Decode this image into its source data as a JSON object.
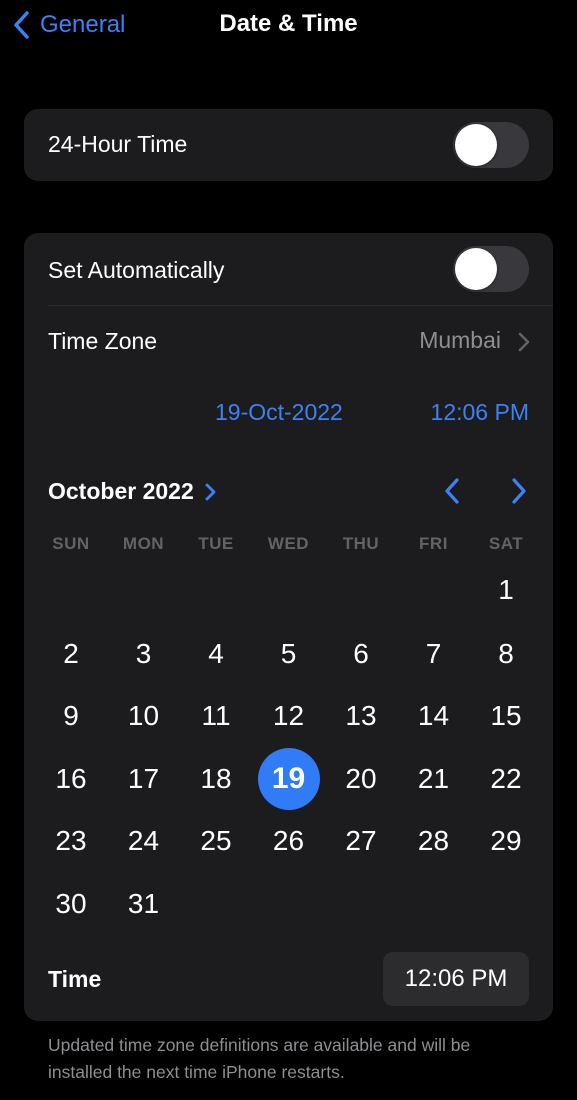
{
  "nav": {
    "back_label": "General",
    "title": "Date & Time"
  },
  "hour24": {
    "label": "24-Hour Time",
    "on": false
  },
  "auto": {
    "label": "Set Automatically",
    "on": false
  },
  "timezone": {
    "label": "Time Zone",
    "value": "Mumbai"
  },
  "summary": {
    "date": "19-Oct-2022",
    "time": "12:06 PM"
  },
  "calendar": {
    "month_label": "October 2022",
    "weekdays": [
      "SUN",
      "MON",
      "TUE",
      "WED",
      "THU",
      "FRI",
      "SAT"
    ],
    "first_weekday_index": 6,
    "day_count": 31,
    "selected_day": 19
  },
  "time_row": {
    "label": "Time",
    "value": "12:06 PM"
  },
  "footnote": "Updated time zone definitions are available and will be installed the next time iPhone restarts.",
  "colors": {
    "accent": "#3b82f6",
    "selected": "#2f7cf6",
    "card": "#1c1c1e"
  }
}
